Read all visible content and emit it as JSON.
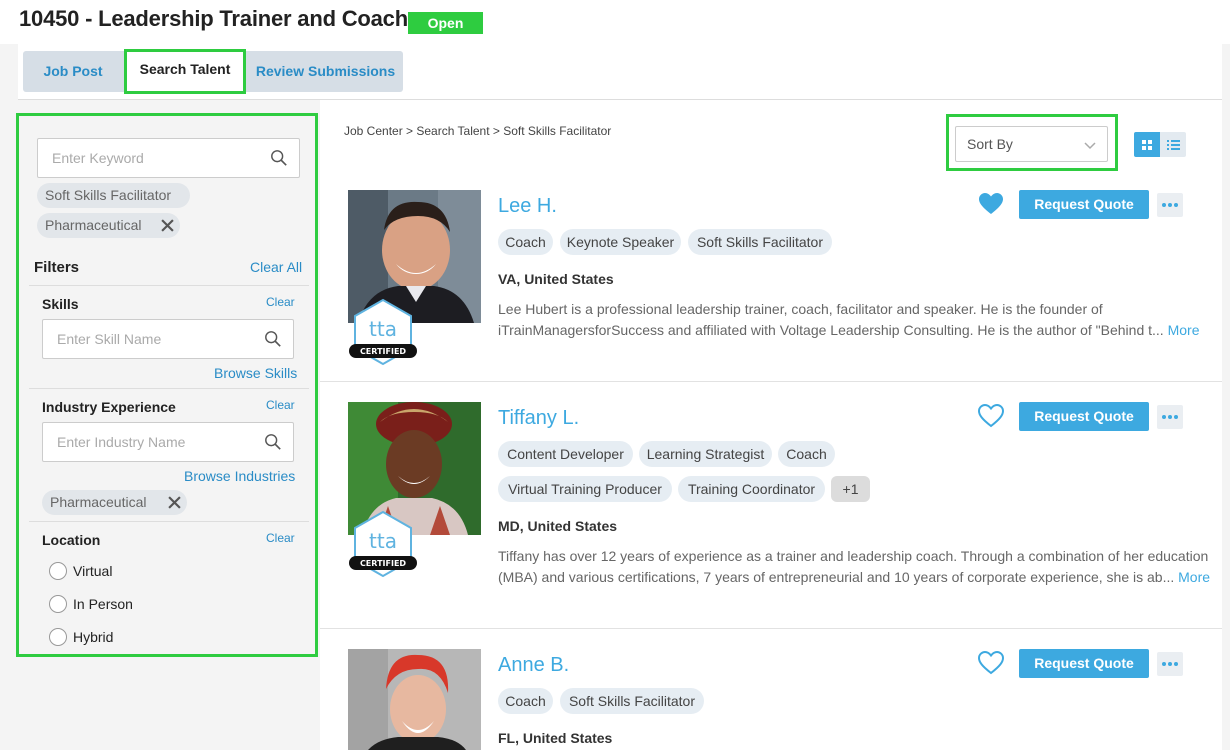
{
  "header": {
    "title": "10450 - Leadership Trainer and Coach",
    "status": "Open"
  },
  "tabs": [
    {
      "label": "Job Post"
    },
    {
      "label": "Search Talent"
    },
    {
      "label": "Review Submissions"
    }
  ],
  "sidebar": {
    "keyword_placeholder": "Enter Keyword",
    "keyword_chips": [
      "Soft Skills Facilitator",
      "Pharmaceutical"
    ],
    "filters_title": "Filters",
    "clear_all": "Clear All",
    "skills": {
      "title": "Skills",
      "clear": "Clear",
      "placeholder": "Enter Skill Name",
      "browse": "Browse Skills"
    },
    "industry": {
      "title": "Industry Experience",
      "clear": "Clear",
      "placeholder": "Enter Industry Name",
      "browse": "Browse Industries",
      "chips": [
        "Pharmaceutical"
      ]
    },
    "location": {
      "title": "Location",
      "clear": "Clear",
      "options": [
        "Virtual",
        "In Person",
        "Hybrid"
      ]
    }
  },
  "main": {
    "breadcrumb": "Job Center > Search Talent > Soft Skills Facilitator",
    "sort_label": "Sort By",
    "certified_label": "CERTIFIED",
    "request_quote_label": "Request Quote",
    "more_label": "More",
    "accent_color": "#3da9e0",
    "highlight_color": "#2ecc40",
    "results": [
      {
        "name": "Lee H.",
        "favorited": true,
        "tags": [
          "Coach",
          "Keynote Speaker",
          "Soft Skills Facilitator"
        ],
        "location": "VA, United States",
        "bio_lines": [
          "Lee Hubert is a professional leadership trainer, coach, facilitator and speaker. He is the founder of",
          "iTrainManagersforSuccess and affiliated with Voltage Leadership Consulting. He is the author of \"Behind t..."
        ]
      },
      {
        "name": "Tiffany L.",
        "favorited": false,
        "tags": [
          "Content Developer",
          "Learning Strategist",
          "Coach",
          "Virtual Training Producer",
          "Training Coordinator"
        ],
        "extra_tags": "+1",
        "location": "MD, United States",
        "bio_lines": [
          "Tiffany has over 12 years of experience as a trainer and leadership coach. Through a combination of her education",
          "(MBA) and various certifications, 7 years of entrepreneurial and 10 years of corporate experience, she is ab..."
        ]
      },
      {
        "name": "Anne B.",
        "favorited": false,
        "tags": [
          "Coach",
          "Soft Skills Facilitator"
        ],
        "location": "FL, United States"
      }
    ]
  }
}
